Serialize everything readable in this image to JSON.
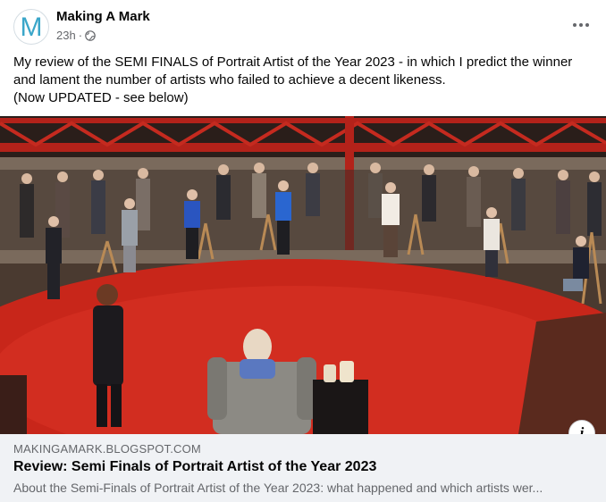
{
  "post": {
    "page_name": "Making A Mark",
    "avatar_letter": "M",
    "timestamp": "23h",
    "separator": "·",
    "audience_icon": "globe-icon",
    "more_icon": "more-horizontal-icon",
    "caption_lines": [
      "My review of the SEMI FINALS  of Portrait Artist of the Year 2023 - in which I predict the winner",
      "and lament the number of artists who failed to achieve a decent likeness.",
      "(Now UPDATED - see below)"
    ]
  },
  "link_preview": {
    "domain": "MAKINGAMARK.BLOGSPOT.COM",
    "title": "Review: Semi Finals of Portrait Artist of the Year 2023",
    "description": "About the Semi-Finals of Portrait Artist of the Year 2023: what happened and which artists wer...",
    "info_label": "i",
    "info_icon": "info-icon"
  },
  "colors": {
    "accent_avatar": "#3aa6c9",
    "secondary_text": "#65676b",
    "card_background": "#f0f2f5",
    "stage_red": "#c8261a"
  }
}
